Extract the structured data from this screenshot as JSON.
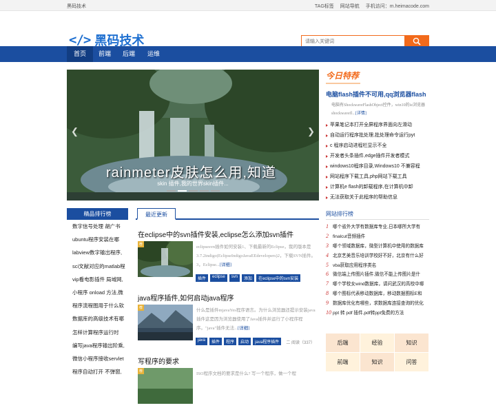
{
  "topbar": {
    "site": "黑码技术",
    "links": [
      "TAG标签",
      "网站导航"
    ],
    "mobile_label": "手机访问：",
    "mobile_url": "m.heimacode.com"
  },
  "logo": {
    "icon": "</>",
    "text": "黑码技术"
  },
  "search": {
    "placeholder": "请输入关键词"
  },
  "nav": {
    "items": [
      "首页",
      "前端",
      "后端",
      "运维"
    ],
    "active": 0
  },
  "banner": {
    "title": "rainmeter皮肤怎么用,知道",
    "caption": "skin 插件,我的世界skin插件..."
  },
  "today": {
    "badge": "今日特荐",
    "headline": "电脑flash插件不可用,qq浏览器flash",
    "summary": "电脑有ShockwaveFlashObject控件，win10的ie浏览器shockwavefl...",
    "more": "[详情]",
    "items": [
      "苹果笔记本打开全屏程序界面向左滑动",
      "自动运行程序批处理,批处理命令运行pyt",
      "c 程序启动进程栏显示不全",
      "开发者头条插件,edge插件开发者模式",
      "windows10程序目录,Windows10 不兼容程",
      "网站程序下载工具,php网站下载工具",
      "计算机e flash的卸载程序,在计算机中卸",
      "无法获取关于此程序的帮助信息"
    ]
  },
  "rank_left": {
    "title": "精品排行榜",
    "items": [
      "数字信号处理 胡广书",
      "ubuntu程序安装在哪",
      "labview数字输出程序,",
      "sci文献对应的matlab程",
      "vip看电影插件 局域网,",
      "小程序 onload 方法,微",
      "程序流程图用于什么软",
      "数据库的高级技术有哪",
      "怎样计算程序运行时",
      "编写java程序输出阶乘,",
      "微信小程序接收servlet",
      "程序自动打开 不弹窗,"
    ]
  },
  "latest": {
    "tab": "最近更新",
    "articles": [
      {
        "title": "在eclipse中的svn插件安装,eclipse怎么添加svn插件",
        "desc": "eclipsesvn插件如何安装1、下载最新的Eclipse，我的版本是3.7.2indigo(EclipseIndigoJavaEEdevelopers)2，下载SVN插件。3，Eclipse...",
        "more": "[详细]",
        "flag": "荐",
        "tags": [
          "插件",
          "eclipse",
          "svn",
          "添加",
          "在eclipse中的svn安装"
        ],
        "meta": ""
      },
      {
        "title": "java程序插件,如何启动java程序",
        "desc": "什么是插件mjavaYes程序语言。为什么浏览器还提示安装java插件这是因为浏览器使用了Java插件并运行了小程序程序。\"java\"插件无法...",
        "more": "[详细]",
        "flag": "荐",
        "tags": [
          "java",
          "插件",
          "程序",
          "启动",
          "java程序插件"
        ],
        "meta": "二 阅读（337）"
      },
      {
        "title": "写程序的要求",
        "desc": "ISO程序文档的要求是什么? 写一个程序，做一个程",
        "more": "",
        "flag": "荐",
        "tags": [],
        "meta": ""
      }
    ]
  },
  "rank_right": {
    "title": "网站排行榜",
    "items": [
      "哪个省外大学有数据库专业,日本哪所大学有",
      "finalcut音频插件",
      "哪个领域数据库，微型计算机中使用的数据库",
      "北京艺美音乐培训学校好不好，北京有什么好",
      "vba获取应用程序类名",
      "微信端上传图片插件,微信不能上传图片是什",
      "哪个学校女wind数据库，请问武汉的高校中哪",
      "哪个图标代表移动数据库，移动数据图标E和",
      "数据库优化有哪些，求数据库连接查询的优化",
      "ppt 转 pdf 插件,pdf转ppt免费的方法"
    ]
  },
  "tag_grid": {
    "items": [
      "后端",
      "经验",
      "知识",
      "前端",
      "知识",
      "问答"
    ]
  },
  "colors": {
    "brand": "#1b4ea0",
    "accent": "#f26a1b"
  }
}
